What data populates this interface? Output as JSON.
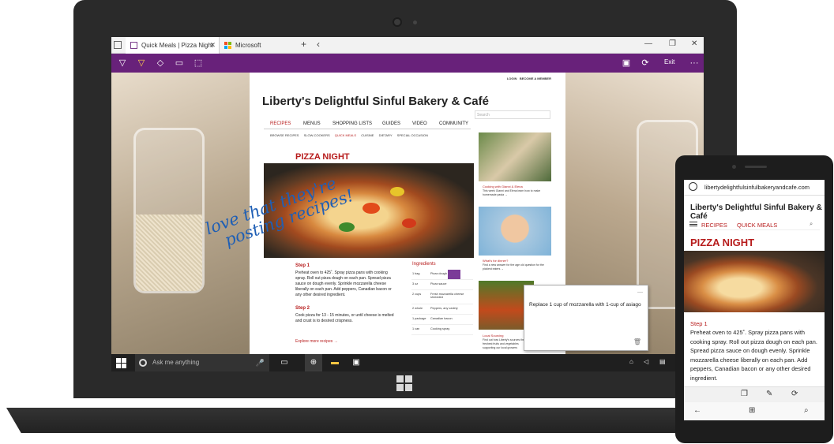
{
  "browser": {
    "tabs": [
      {
        "label": "Quick Meals | Pizza Night",
        "active": true
      },
      {
        "label": "Microsoft",
        "active": false
      }
    ],
    "new_tab": "+",
    "back": "‹",
    "exit_label": "Exit",
    "more": "···",
    "accent_color": "#68217a"
  },
  "site": {
    "login": "LOGIN",
    "member": "BECOME A MEMBER",
    "title": "Liberty's Delightful Sinful Bakery & Café",
    "search_placeholder": "Search",
    "nav": [
      "RECIPES",
      "MENUS",
      "SHOPPING LISTS",
      "GUIDES",
      "VIDEO",
      "COMMUNITY"
    ],
    "subnav": [
      "BROWSE RECIPES",
      "SLOW-COOKERS",
      "QUICK MEALS",
      "CUISINE",
      "DIETARY",
      "SPECIAL OCCASION"
    ],
    "page_title": "PIZZA NIGHT",
    "step1_title": "Step 1",
    "step1_text": "Preheat oven to 425˚. Spray pizza pans with cooking spray. Roll out pizza dough on each pan. Spread pizza sauce on dough evenly. Sprinkle mozzarella cheese liberally on each pan. Add peppers, Canadian bacon or any other desired ingredient.",
    "step2_title": "Step 2",
    "step2_text": "Cook pizza for 13 - 15 minutes, or until cheese is melted and  crust is to desired crispness.",
    "explore": "Explore more recipes →",
    "ingredients_title": "Ingredients",
    "ingredients": [
      {
        "qty": "1 bag",
        "name": "Pizza dough"
      },
      {
        "qty": "3 oz",
        "name": "Pizza sauce"
      },
      {
        "qty": "2 cups",
        "name": "Fresh mozzarella cheese shredded"
      },
      {
        "qty": "2 whole",
        "name": "Peppers, any variety"
      },
      {
        "qty": "1 package",
        "name": "Canadian bacon"
      },
      {
        "qty": "1 can",
        "name": "Cooking spray"
      }
    ],
    "sidebar": [
      {
        "title": "Cooking with Gianni & Elena",
        "text": "This week Gianni and Elena learn how to make homemade pasta →"
      },
      {
        "title": "What's for dinner?",
        "text": "Find a new answer for the age old question for the pickiest eaters →"
      },
      {
        "title": "Local Sourcing",
        "text": "Find out how Liberty's sources the freshest fruits and vegetables supporting our local growers"
      }
    ],
    "handwriting_line1": "love that they're",
    "handwriting_line2": "posting recipes!",
    "comment_text": "Replace 1 cup of mozzarella with 1-cup of asiago",
    "comment_minus": "—",
    "comment_trash": "🗑"
  },
  "taskbar": {
    "search_placeholder": "Ask me anything",
    "mic": "🎤"
  },
  "phone": {
    "url": "libertydelightfulsinfulbakeryandcafe.com",
    "title": "Liberty's Delightful Sinful Bakery & Café",
    "nav_recipes": "RECIPES",
    "nav_quick": "QUICK MEALS",
    "page_title": "PIZZA NIGHT",
    "step1_title": "Step 1",
    "step1_text": "Preheat oven to 425˚. Spray pizza pans with cooking spray. Roll out pizza dough on each pan. Spread pizza sauce on dough evenly. Sprinkle mozzarella cheese liberally on each pan. Add peppers, Canadian bacon or any other desired ingredient."
  }
}
